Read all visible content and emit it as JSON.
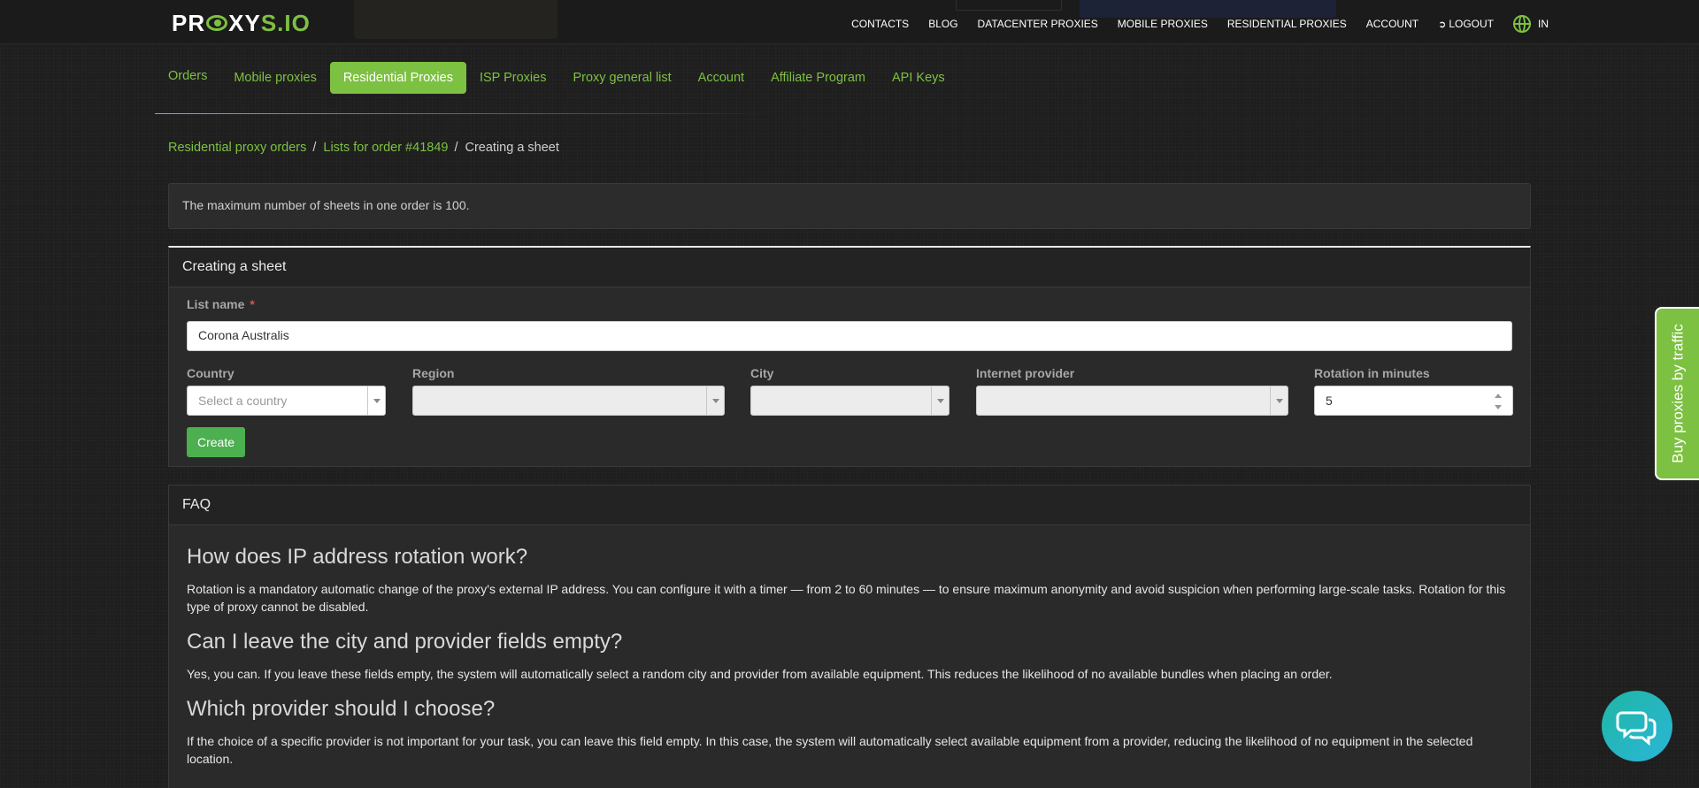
{
  "brand": {
    "logo_left": "PR",
    "logo_mid": "XY",
    "logo_right": "S.IO"
  },
  "top_nav": {
    "items": [
      "CONTACTS",
      "BLOG",
      "DATACENTER PROXIES",
      "MOBILE PROXIES",
      "RESIDENTIAL PROXIES",
      "ACCOUNT"
    ],
    "logout": "LOGOUT",
    "lang": "IN"
  },
  "sub_nav": {
    "tabs": [
      "Orders",
      "Mobile proxies",
      "Residential Proxies",
      "ISP Proxies",
      "Proxy general list",
      "Account",
      "Affiliate Program",
      "API Keys"
    ],
    "active": "Residential Proxies"
  },
  "breadcrumb": {
    "items": [
      "Residential proxy orders",
      "Lists for order #41849"
    ],
    "separator": "/",
    "current": "Creating a sheet"
  },
  "alert": {
    "text": "The maximum number of sheets in one order is 100."
  },
  "form": {
    "title": "Creating a sheet",
    "list_name_label": "List name",
    "required_mark": "*",
    "list_name_value": "Corona Australis",
    "country_label": "Country",
    "country_placeholder": "Select a country",
    "region_label": "Region",
    "city_label": "City",
    "provider_label": "Internet provider",
    "rotation_label": "Rotation in minutes",
    "rotation_value": "5",
    "create_button": "Create"
  },
  "faq": {
    "title": "FAQ",
    "items": [
      {
        "q": "How does IP address rotation work?",
        "a": "Rotation is a mandatory automatic change of the proxy's external IP address. You can configure it with a timer — from 2 to 60 minutes — to ensure maximum anonymity and avoid suspicion when performing large-scale tasks. Rotation for this type of proxy cannot be disabled."
      },
      {
        "q": "Can I leave the city and provider fields empty?",
        "a": "Yes, you can. If you leave these fields empty, the system will automatically select a random city and provider from available equipment. This reduces the likelihood of no available bundles when placing an order."
      },
      {
        "q": "Which provider should I choose?",
        "a": "If the choice of a specific provider is not important for your task, you can leave this field empty. In this case, the system will automatically select available equipment from a provider, reducing the likelihood of no equipment in the selected location."
      }
    ]
  },
  "side_tab": {
    "label": "Buy proxies by traffic"
  },
  "colors": {
    "accent": "#7dc142",
    "create_button": "#4caf50",
    "background": "#1e1e1e"
  }
}
